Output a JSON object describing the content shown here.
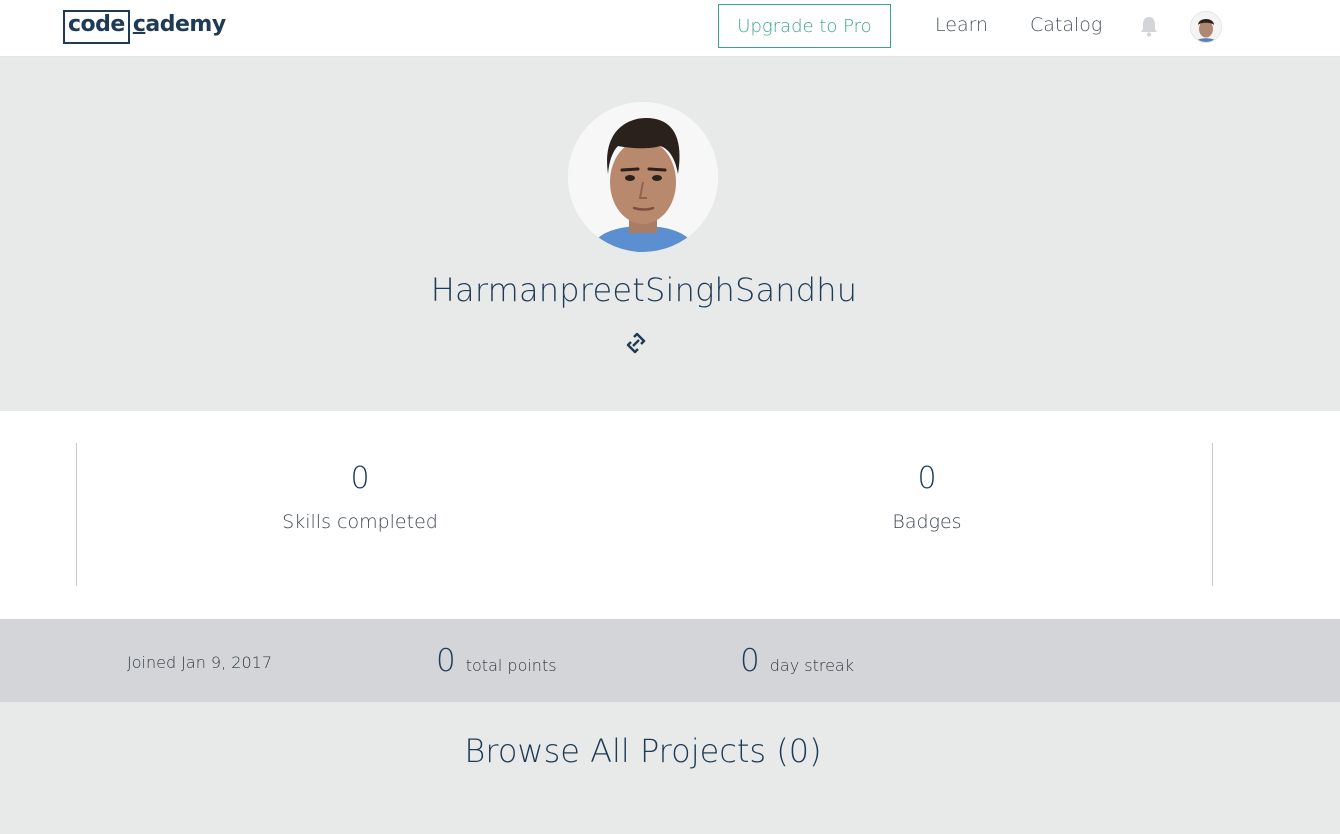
{
  "header": {
    "logo_code": "code",
    "logo_rest_underlined": "c",
    "logo_rest": "ademy",
    "upgrade_label": "Upgrade to Pro",
    "nav": [
      {
        "label": "Learn"
      },
      {
        "label": "Catalog"
      }
    ],
    "bell_icon": "bell-icon",
    "avatar_icon": "user-avatar"
  },
  "profile": {
    "username": "HarmanpreetSinghSandhu",
    "link_icon": "link-icon"
  },
  "stats": {
    "skills": {
      "value": "0",
      "label": "Skills completed"
    },
    "badges": {
      "value": "0",
      "label": "Badges"
    }
  },
  "meta": {
    "joined": "Joined Jan 9, 2017",
    "points_value": "0",
    "points_label": "total points",
    "streak_value": "0",
    "streak_label": "day streak"
  },
  "projects": {
    "title": "Browse All Projects (0)"
  },
  "colors": {
    "brand": "#1f3a55",
    "accent": "#3aa58d",
    "hero_bg": "#e8eaea",
    "meta_bg": "#d3d5d8"
  }
}
